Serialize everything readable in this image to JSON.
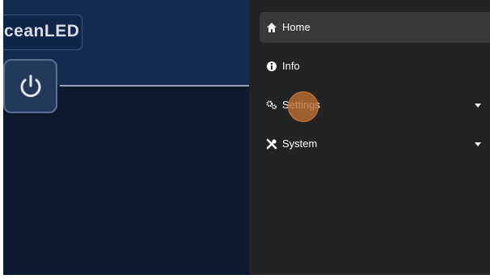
{
  "brand": {
    "logo_text": "ceanLED"
  },
  "menu": {
    "items": [
      {
        "label": "Home",
        "icon": "home-icon"
      },
      {
        "label": "Info",
        "icon": "info-icon"
      },
      {
        "label": "Settings",
        "icon": "gears-icon"
      },
      {
        "label": "System",
        "icon": "tools-icon"
      }
    ]
  },
  "colors": {
    "header_blue": "#142a50",
    "panel_navy": "#0c1a30",
    "drawer_bg": "#232323",
    "active_item_bg": "#383838",
    "ripple": "#be6e32"
  }
}
